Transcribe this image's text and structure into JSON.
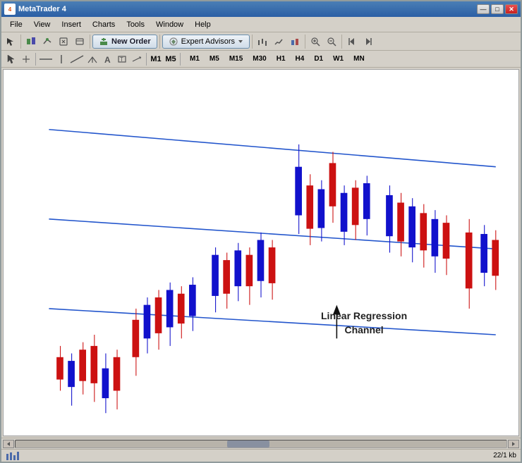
{
  "window": {
    "title": "MetaTrader 4",
    "icon": "MT4"
  },
  "title_buttons": {
    "minimize": "—",
    "maximize": "□",
    "close": "✕"
  },
  "menu": {
    "items": [
      "File",
      "View",
      "Insert",
      "Charts",
      "Tools",
      "Window",
      "Help"
    ]
  },
  "toolbar1": {
    "new_order_label": "New Order",
    "expert_advisors_label": "Expert Advisors"
  },
  "timeframes": {
    "items": [
      "M1",
      "M5",
      "M15",
      "M30",
      "H1",
      "H4",
      "D1",
      "W1",
      "MN"
    ]
  },
  "chart_label": {
    "line1": "Linear Regression",
    "line2": "Channel"
  },
  "status_bar": {
    "right": "22/1 kb"
  },
  "colors": {
    "candle_bull": "#1111cc",
    "candle_bear": "#cc1111",
    "channel": "#2255cc",
    "accent": "#2b5fa5"
  }
}
